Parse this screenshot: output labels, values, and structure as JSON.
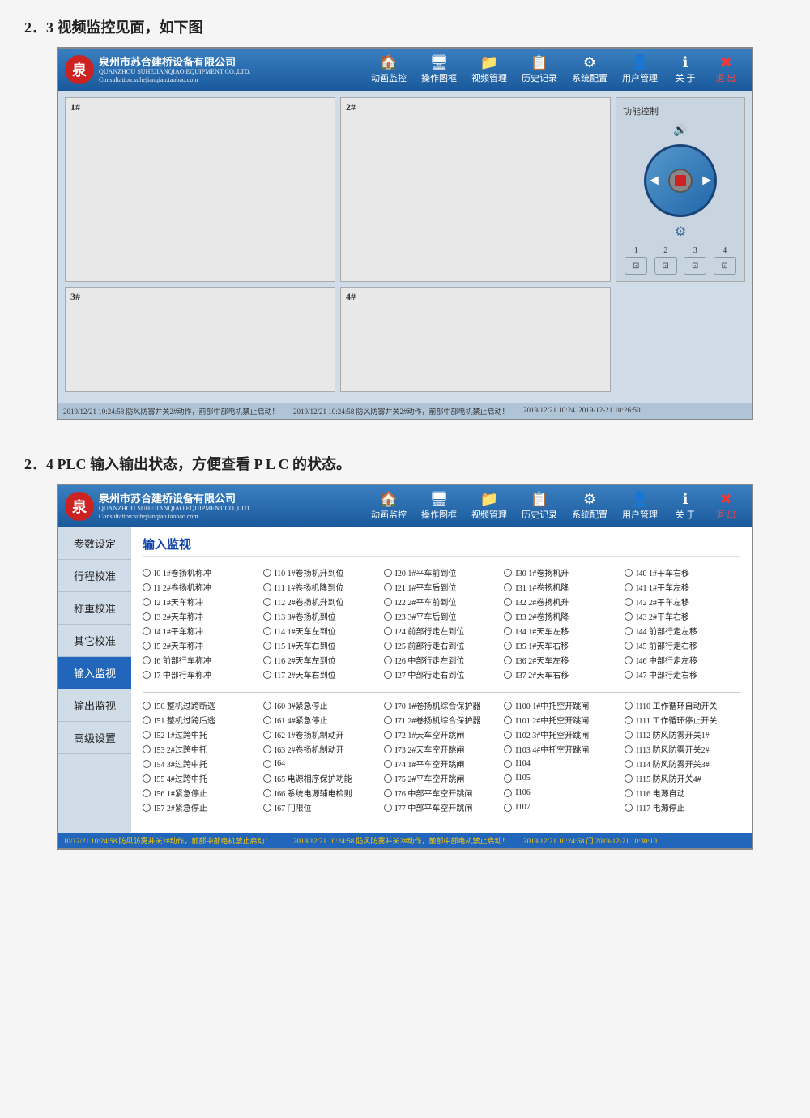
{
  "section1": {
    "heading": "2．3 视频监控见面，如下图",
    "app": {
      "company_cn": "泉州市苏合建桥设备有限公司",
      "company_en_line1": "QUANZHOU SUHEJIANQIAO EQUIPMENT CO.,LTD.",
      "company_en_line2": "Consultation:suhejianqiao.taobao.com",
      "nav": [
        {
          "icon": "🏠",
          "label": "动画监控"
        },
        {
          "icon": "🖥",
          "label": "操作图框"
        },
        {
          "icon": "📁",
          "label": "视频管理"
        },
        {
          "icon": "📋",
          "label": "历史记录"
        },
        {
          "icon": "⚙",
          "label": "系统配置"
        },
        {
          "icon": "👤",
          "label": "用户管理"
        },
        {
          "icon": "ℹ",
          "label": "关 于"
        },
        {
          "icon": "✖",
          "label": "退 出"
        }
      ],
      "video_panels": [
        {
          "id": "1",
          "label": "1#"
        },
        {
          "id": "2",
          "label": "2#"
        },
        {
          "id": "3",
          "label": "3#"
        },
        {
          "id": "4",
          "label": "4#"
        }
      ],
      "control_panel": {
        "title": "功能控制",
        "cam_nums": [
          "1",
          "2",
          "3",
          "4"
        ]
      },
      "status_items": [
        "2019/12/21 10:24:58 防风防雾并关2#动作，前部中部电机禁止启动！",
        "2019/12/21 10:24:58 防风防雾并关2#动作，前部中部电机禁止启动！",
        "2019/12/21 10:24. 2019-12-21 10:26:50"
      ]
    }
  },
  "section2": {
    "heading": "2．4 PLC 输入输出状态，方便查看 P L C 的状态。",
    "app": {
      "company_cn": "泉州市苏合建桥设备有限公司",
      "company_en_line1": "QUANZHOU SUHEJIANQIAO EQUIPMENT CO.,LTD.",
      "company_en_line2": "Consultation:suhejianqiao.taobao.com",
      "nav": [
        {
          "icon": "🏠",
          "label": "动画监控"
        },
        {
          "icon": "🖥",
          "label": "操作图框"
        },
        {
          "icon": "📁",
          "label": "视频管理"
        },
        {
          "icon": "📋",
          "label": "历史记录"
        },
        {
          "icon": "⚙",
          "label": "系统配置"
        },
        {
          "icon": "👤",
          "label": "用户管理"
        },
        {
          "icon": "ℹ",
          "label": "关 于"
        },
        {
          "icon": "✖",
          "label": "退 出"
        }
      ],
      "sidebar_items": [
        {
          "label": "参数设定",
          "active": false
        },
        {
          "label": "行程校准",
          "active": false
        },
        {
          "label": "称重校准",
          "active": false
        },
        {
          "label": "其它校准",
          "active": false
        },
        {
          "label": "输入监视",
          "active": true
        },
        {
          "label": "输出监视",
          "active": false
        },
        {
          "label": "高级设置",
          "active": false
        }
      ],
      "main_title": "输入监视",
      "io_group1": [
        {
          "addr": "I0",
          "desc": "1#卷扬机称冲"
        },
        {
          "addr": "I10",
          "desc": "1#卷扬机升到位"
        },
        {
          "addr": "I20",
          "desc": "1#平车前到位"
        },
        {
          "addr": "I30",
          "desc": "1#卷扬机升"
        },
        {
          "addr": "I40",
          "desc": "1#平车右移"
        },
        {
          "addr": "I1",
          "desc": "2#卷扬机称冲"
        },
        {
          "addr": "I11",
          "desc": "1#卷扬机降到位"
        },
        {
          "addr": "I21",
          "desc": "1#平车后到位"
        },
        {
          "addr": "I31",
          "desc": "1#卷扬机降"
        },
        {
          "addr": "I41",
          "desc": "1#平车左移"
        },
        {
          "addr": "I2",
          "desc": "1#天车称冲"
        },
        {
          "addr": "I12",
          "desc": "2#卷扬机升到位"
        },
        {
          "addr": "I22",
          "desc": "2#平车前到位"
        },
        {
          "addr": "I32",
          "desc": "2#卷扬机升"
        },
        {
          "addr": "I42",
          "desc": "2#平车左移"
        },
        {
          "addr": "I3",
          "desc": "2#天车称冲"
        },
        {
          "addr": "I13",
          "desc": "3#卷扬机到位"
        },
        {
          "addr": "I23",
          "desc": "3#平车后到位"
        },
        {
          "addr": "I33",
          "desc": "2#卷扬机降"
        },
        {
          "addr": "I43",
          "desc": "2#平车右移"
        },
        {
          "addr": "I4",
          "desc": "1#平车称冲"
        },
        {
          "addr": "I14",
          "desc": "1#天车左到位"
        },
        {
          "addr": "I24",
          "desc": "前部行走左到位"
        },
        {
          "addr": "I34",
          "desc": "1#天车左移"
        },
        {
          "addr": "I44",
          "desc": "前部行走左移"
        },
        {
          "addr": "I5",
          "desc": "2#天车称冲"
        },
        {
          "addr": "I15",
          "desc": "1#天车右到位"
        },
        {
          "addr": "I25",
          "desc": "前部行走右到位"
        },
        {
          "addr": "I35",
          "desc": "1#天车右移"
        },
        {
          "addr": "I45",
          "desc": "前部行走右移"
        },
        {
          "addr": "I6",
          "desc": "前部行车称冲"
        },
        {
          "addr": "I16",
          "desc": "2#天车左到位"
        },
        {
          "addr": "I26",
          "desc": "中部行走左到位"
        },
        {
          "addr": "I36",
          "desc": "2#天车左移"
        },
        {
          "addr": "I46",
          "desc": "中部行走左移"
        },
        {
          "addr": "I7",
          "desc": "中部行车称冲"
        },
        {
          "addr": "I17",
          "desc": "2#天车右到位"
        },
        {
          "addr": "I27",
          "desc": "中部行走右到位"
        },
        {
          "addr": "I37",
          "desc": "2#天车右移"
        },
        {
          "addr": "I47",
          "desc": "中部行走右移"
        }
      ],
      "io_group2": [
        {
          "addr": "I50",
          "desc": "整机过跨断逃"
        },
        {
          "addr": "I60",
          "desc": "3#紧急停止"
        },
        {
          "addr": "I70",
          "desc": "1#卷扬机综合保护器"
        },
        {
          "addr": "I100",
          "desc": "1#中托空开跳闸"
        },
        {
          "addr": "I110",
          "desc": "工作循环自动开关"
        },
        {
          "addr": "I51",
          "desc": "整机过跨后逃"
        },
        {
          "addr": "I61",
          "desc": "4#紧急停止"
        },
        {
          "addr": "I71",
          "desc": "2#卷扬机综合保护器"
        },
        {
          "addr": "I101",
          "desc": "2#中托空开跳闸"
        },
        {
          "addr": "I111",
          "desc": "工作循环停止开关"
        },
        {
          "addr": "I52",
          "desc": "1#过跨中托"
        },
        {
          "addr": "I62",
          "desc": "1#卷扬机制动开"
        },
        {
          "addr": "I72",
          "desc": "1#天车空开跳闸"
        },
        {
          "addr": "I102",
          "desc": "3#中托空开跳闸"
        },
        {
          "addr": "I112",
          "desc": "防风防雾开关1#"
        },
        {
          "addr": "I53",
          "desc": "2#过跨中托"
        },
        {
          "addr": "I63",
          "desc": "2#卷扬机制动开"
        },
        {
          "addr": "I73",
          "desc": "2#天车空开跳闸"
        },
        {
          "addr": "I103",
          "desc": "4#中托空开跳闸"
        },
        {
          "addr": "I113",
          "desc": "防风防雾开关2#"
        },
        {
          "addr": "I54",
          "desc": "3#过跨中托"
        },
        {
          "addr": "I64",
          "desc": ""
        },
        {
          "addr": "I74",
          "desc": "1#平车空开跳闸"
        },
        {
          "addr": "I104",
          "desc": ""
        },
        {
          "addr": "I114",
          "desc": "防风防雾开关3#"
        },
        {
          "addr": "I55",
          "desc": "4#过跨中托"
        },
        {
          "addr": "I65",
          "desc": "电源相序保护功能"
        },
        {
          "addr": "I75",
          "desc": "2#平车空开跳闸"
        },
        {
          "addr": "I105",
          "desc": ""
        },
        {
          "addr": "I115",
          "desc": "防风防开关4#"
        },
        {
          "addr": "I56",
          "desc": "1#紧急停止"
        },
        {
          "addr": "I66",
          "desc": "系统电源辅电检则"
        },
        {
          "addr": "I76",
          "desc": "中部平车空开跳闸"
        },
        {
          "addr": "I106",
          "desc": ""
        },
        {
          "addr": "I116",
          "desc": "电源自动"
        },
        {
          "addr": "I57",
          "desc": "2#紧急停止"
        },
        {
          "addr": "I67",
          "desc": "门限位"
        },
        {
          "addr": "I77",
          "desc": "中部平车空开跳闸"
        },
        {
          "addr": "I107",
          "desc": ""
        },
        {
          "addr": "I117",
          "desc": "电源停止"
        }
      ],
      "status_items": [
        "10/12/21 10:24:58 防风防雾并关2#动作，前部中部电机禁止启动！",
        "2019/12/21 10:24:58 防风防雾并关2#动作，前部中部电机禁止启动！",
        "2019/12/21 10:24:58 门  2019-12-21 10:30:10"
      ]
    }
  }
}
